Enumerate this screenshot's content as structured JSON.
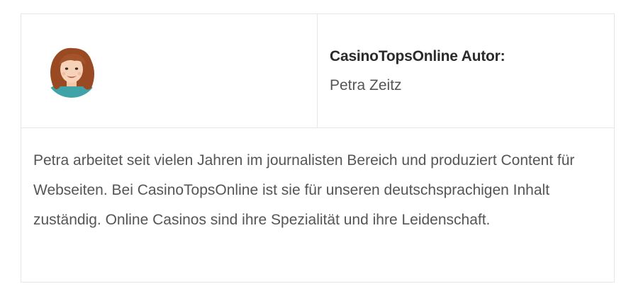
{
  "author_box": {
    "title": "CasinoTopsOnline Autor:",
    "name": "Petra Zeitz",
    "bio": "Petra arbeitet seit vielen Jahren im journalisten Bereich und produziert Content für Webseiten. Bei CasinoTopsOnline ist sie für unseren deutschsprachigen Inhalt zuständig. Online Casinos sind ihre Spezialität und ihre Leidenschaft.",
    "avatar_icon": "author-portrait-icon"
  },
  "colors": {
    "border": "#e6e6e6",
    "title_text": "#2b2b2b",
    "body_text": "#555555",
    "hair": "#9a4a22",
    "shirt": "#3fa3a8"
  }
}
